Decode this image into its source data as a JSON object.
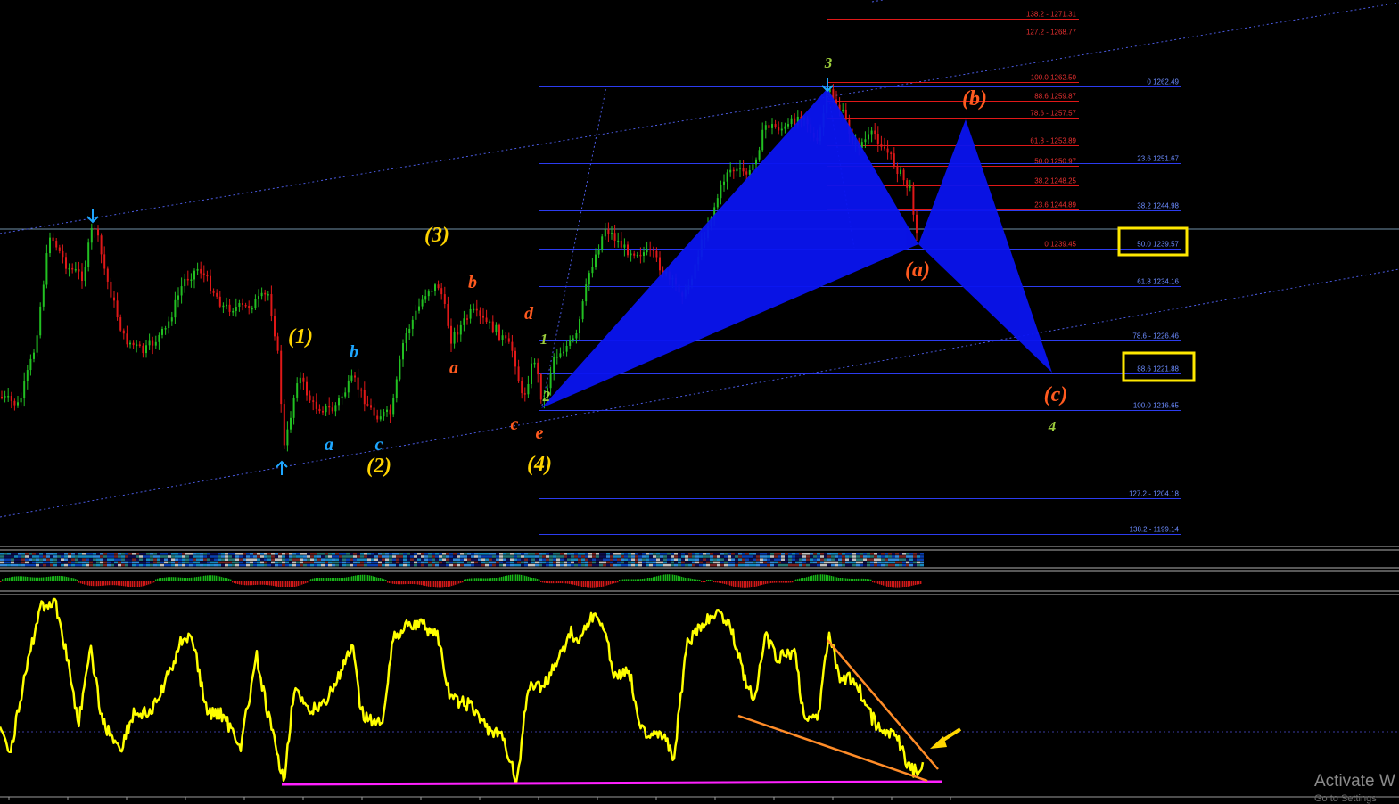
{
  "price_panel": {
    "fib_levels_red": [
      {
        "label": "138.2 - 1271.31",
        "ratio": 1.382,
        "price": 1271.31
      },
      {
        "label": "127.2 - 1268.77",
        "ratio": 1.272,
        "price": 1268.77
      },
      {
        "label": "100.0 1262.50",
        "ratio": 1.0,
        "price": 1262.5
      },
      {
        "label": "88.6 1259.87",
        "ratio": 0.886,
        "price": 1259.87
      },
      {
        "label": "78.6 - 1257.57",
        "ratio": 0.786,
        "price": 1257.57
      },
      {
        "label": "61.8 - 1253.89",
        "ratio": 0.618,
        "price": 1253.89
      },
      {
        "label": "50.0 1250.97",
        "ratio": 0.5,
        "price": 1250.97
      },
      {
        "label": "38.2 1248.25",
        "ratio": 0.382,
        "price": 1248.25
      },
      {
        "label": "23.6 1244.89",
        "ratio": 0.236,
        "price": 1244.89
      },
      {
        "label": "0 1239.45",
        "ratio": 0.0,
        "price": 1239.45
      }
    ],
    "fib_levels_blue": [
      {
        "label": "0 1262.49",
        "ratio": 0.0,
        "price": 1262.49
      },
      {
        "label": "23.6 1251.67",
        "ratio": 0.236,
        "price": 1251.67
      },
      {
        "label": "38.2 1244.98",
        "ratio": 0.382,
        "price": 1244.98
      },
      {
        "label": "50.0 1239.57",
        "ratio": 0.5,
        "price": 1239.57
      },
      {
        "label": "61.8 1234.16",
        "ratio": 0.618,
        "price": 1234.16
      },
      {
        "label": "78.6 - 1226.46",
        "ratio": 0.786,
        "price": 1226.46
      },
      {
        "label": "88.6 1221.88",
        "ratio": 0.886,
        "price": 1221.88
      },
      {
        "label": "100.0 1216.65",
        "ratio": 1.0,
        "price": 1216.65
      },
      {
        "label": "127.2 - 1204.18",
        "ratio": 1.272,
        "price": 1204.18
      },
      {
        "label": "138.2 - 1199.14",
        "ratio": 1.382,
        "price": 1199.14
      }
    ],
    "highlighted_levels": [
      "50.0 1239.57",
      "88.6 1221.88"
    ],
    "wave_labels": [
      {
        "text": "(1)",
        "color": "#ffd400"
      },
      {
        "text": "(2)",
        "color": "#ffd400"
      },
      {
        "text": "(3)",
        "color": "#ffd400"
      },
      {
        "text": "(4)",
        "color": "#ffd400"
      },
      {
        "text": "a",
        "color": "#1ea7ff"
      },
      {
        "text": "b",
        "color": "#1ea7ff"
      },
      {
        "text": "c",
        "color": "#1ea7ff"
      },
      {
        "text": "a",
        "color": "#ff5a1f"
      },
      {
        "text": "b",
        "color": "#ff5a1f"
      },
      {
        "text": "c",
        "color": "#ff5a1f"
      },
      {
        "text": "d",
        "color": "#ff5a1f"
      },
      {
        "text": "e",
        "color": "#ff5a1f"
      },
      {
        "text": "1",
        "color": "#9ccc3c"
      },
      {
        "text": "2",
        "color": "#9ccc3c"
      },
      {
        "text": "3",
        "color": "#9ccc3c"
      },
      {
        "text": "4",
        "color": "#9ccc3c"
      },
      {
        "text": "(a)",
        "color": "#ff5a1f"
      },
      {
        "text": "(b)",
        "color": "#ff5a1f"
      },
      {
        "text": "(c)",
        "color": "#ff5a1f"
      }
    ],
    "colors": {
      "background": "#000000",
      "bull_candle": "#22c022",
      "bear_candle": "#e01818",
      "harmonic_pattern": "#0a14f0",
      "channel": "#4a5ae0",
      "highlight_box": "#ffe800"
    }
  },
  "oscillator_panel": {
    "line_color": "#ffff00",
    "trendline_color": "#ff8c28",
    "support_color": "#ff20ff",
    "arrow_color": "#ffd700"
  },
  "watermark": {
    "line1": "Activate W",
    "line2": "Go to Settings"
  }
}
